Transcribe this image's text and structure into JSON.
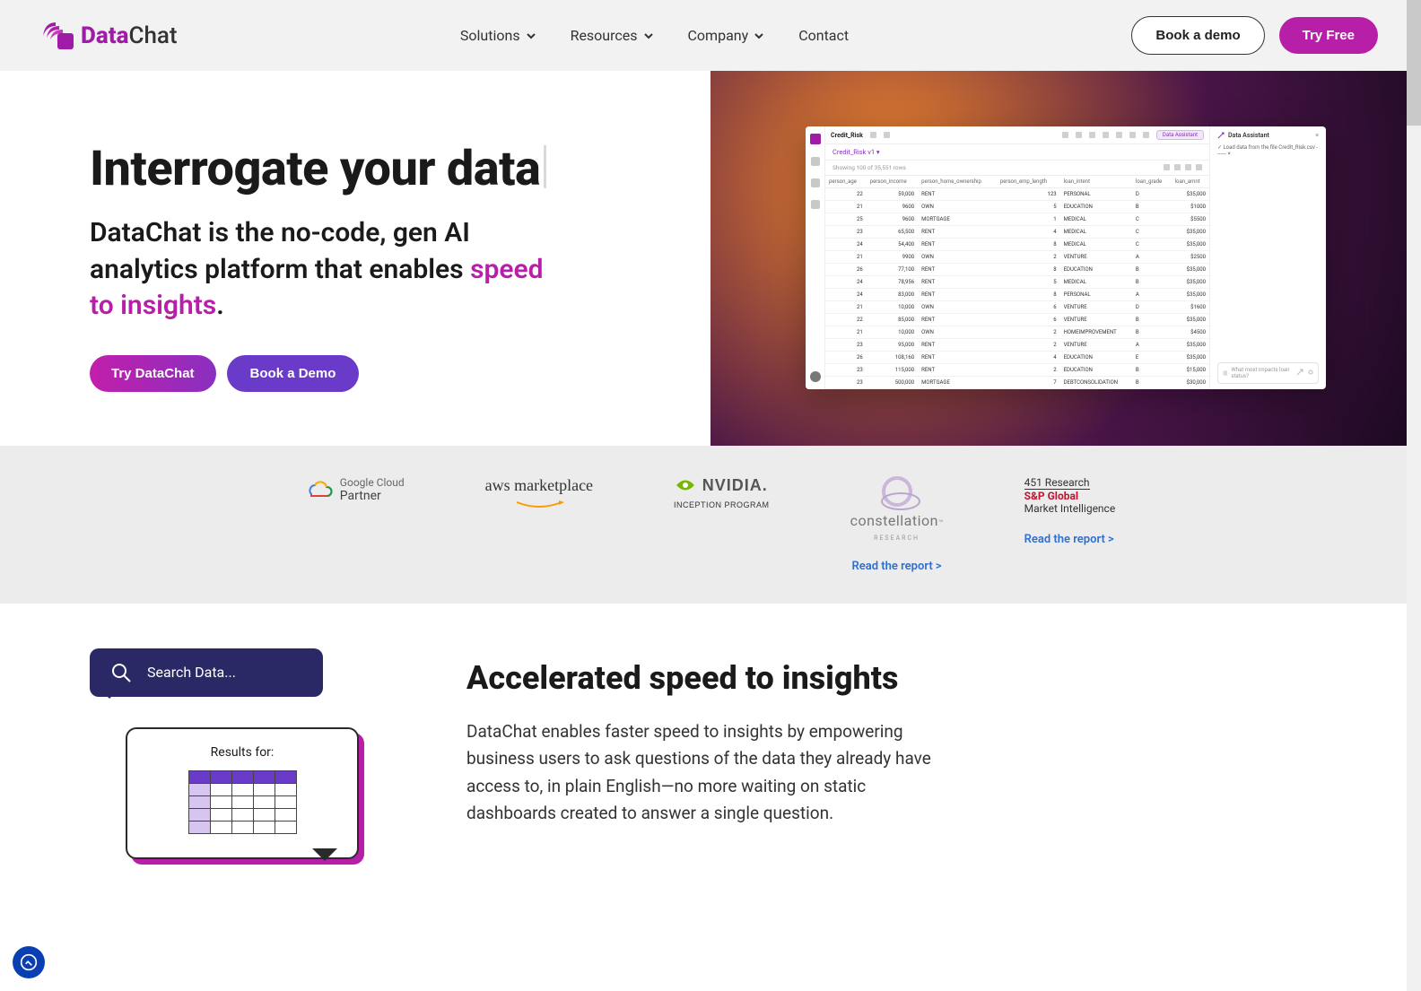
{
  "nav": {
    "brand_data": "Data",
    "brand_chat": "Chat",
    "items": [
      {
        "label": "Solutions",
        "has_chevron": true
      },
      {
        "label": "Resources",
        "has_chevron": true
      },
      {
        "label": "Company",
        "has_chevron": true
      },
      {
        "label": "Contact",
        "has_chevron": false
      }
    ],
    "cta_demo": "Book a demo",
    "cta_try": "Try Free"
  },
  "hero": {
    "title": "Interrogate your data",
    "sub_a": "DataChat is the no-code, gen AI analytics platform that enables ",
    "sub_accent": "speed to insights",
    "sub_b": ".",
    "btn_try": "Try DataChat",
    "btn_demo": "Book a Demo"
  },
  "app": {
    "tab": "Credit_Risk",
    "pill": "Data Assistant",
    "subtab": "Credit_Risk v1 ▾",
    "showing": "Showing 100 of 35,551 rows",
    "assistant_head": "Data Assistant",
    "assistant_line": "✓  Load data from the file Credit_Risk.csv  -------  ×",
    "assistant_prompt": "What most impacts loan status?",
    "columns": [
      "person_age",
      "person_income",
      "person_home_ownership",
      "person_emp_length",
      "loan_intent",
      "loan_grade",
      "loan_amnt"
    ],
    "rows": [
      [
        "22",
        "59,000",
        "RENT",
        "123",
        "PERSONAL",
        "D",
        "$35,000"
      ],
      [
        "21",
        "9600",
        "OWN",
        "5",
        "EDUCATION",
        "B",
        "$1000"
      ],
      [
        "25",
        "9600",
        "MORTGAGE",
        "1",
        "MEDICAL",
        "C",
        "$5500"
      ],
      [
        "23",
        "65,500",
        "RENT",
        "4",
        "MEDICAL",
        "C",
        "$35,000"
      ],
      [
        "24",
        "54,400",
        "RENT",
        "8",
        "MEDICAL",
        "C",
        "$35,000"
      ],
      [
        "21",
        "9900",
        "OWN",
        "2",
        "VENTURE",
        "A",
        "$2500"
      ],
      [
        "26",
        "77,100",
        "RENT",
        "8",
        "EDUCATION",
        "B",
        "$35,000"
      ],
      [
        "24",
        "78,956",
        "RENT",
        "5",
        "MEDICAL",
        "B",
        "$35,000"
      ],
      [
        "24",
        "83,000",
        "RENT",
        "8",
        "PERSONAL",
        "A",
        "$35,000"
      ],
      [
        "21",
        "10,000",
        "OWN",
        "6",
        "VENTURE",
        "D",
        "$1600"
      ],
      [
        "22",
        "85,000",
        "RENT",
        "6",
        "VENTURE",
        "B",
        "$35,000"
      ],
      [
        "21",
        "10,000",
        "OWN",
        "2",
        "HOMEIMPROVEMENT",
        "B",
        "$4500"
      ],
      [
        "23",
        "95,000",
        "RENT",
        "2",
        "VENTURE",
        "A",
        "$35,000"
      ],
      [
        "26",
        "108,160",
        "RENT",
        "4",
        "EDUCATION",
        "E",
        "$35,000"
      ],
      [
        "23",
        "115,000",
        "RENT",
        "2",
        "EDUCATION",
        "B",
        "$15,000"
      ],
      [
        "23",
        "500,000",
        "MORTGAGE",
        "7",
        "DEBTCONSOLIDATION",
        "B",
        "$30,000"
      ]
    ]
  },
  "partners": {
    "gcloud_a": "Google Cloud",
    "gcloud_b": "Partner",
    "aws": "aws marketplace",
    "nvidia_main": "NVIDIA.",
    "nvidia_sub": "INCEPTION PROGRAM",
    "const_name": "constellation",
    "const_sub": "RESEARCH",
    "sp_1": "451 Research",
    "sp_2": "S&P Global",
    "sp_3": "Market Intelligence",
    "report_link": "Read the report >"
  },
  "speed": {
    "search_placeholder": "Search Data...",
    "results_title": "Results for:",
    "heading": "Accelerated speed to insights",
    "body": "DataChat enables faster speed to insights by empowering business users to ask questions of the data they already have access to, in plain English—no more waiting on static dashboards created to answer a single question."
  }
}
